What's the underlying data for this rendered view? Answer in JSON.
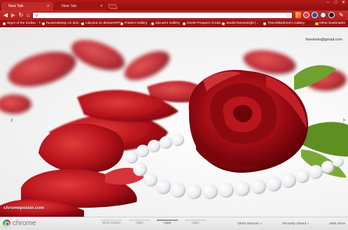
{
  "tabs": [
    {
      "label": "New Tab"
    },
    {
      "label": "New Tab"
    }
  ],
  "omnibox": {
    "value": "",
    "placeholder": ""
  },
  "bookmarks": [
    {
      "label": "Signs of the Zodiac - T..."
    },
    {
      "label": "hussendesign on devi..."
    },
    {
      "label": "Lilacyka on deviantART"
    },
    {
      "label": "Prasa's Gallery"
    },
    {
      "label": "alicuus's Gallery"
    },
    {
      "label": "Derek Prospero Creati..."
    },
    {
      "label": "StudioTwentyEight |..."
    },
    {
      "label": "TheUnlikedOne's Gallery"
    },
    {
      "label": "Other bookmarks"
    }
  ],
  "user": {
    "email": "thevinela@gmail.com"
  },
  "watermark": {
    "text": "chromeposter.com"
  },
  "bottom": {
    "brand": "chrome",
    "sections": [
      {
        "label": "Most visited"
      },
      {
        "label": "Apps"
      },
      {
        "label": "Apps"
      },
      {
        "label": "Apps"
      }
    ],
    "other_devices": "Other Devices",
    "recently_closed": "Recently closed",
    "web_store": "Web Store"
  },
  "icons": {
    "back": "back-arrow-icon",
    "forward": "forward-arrow-icon",
    "reload": "reload-icon",
    "home": "home-icon",
    "star": "star-icon",
    "wrench": "wrench-icon"
  },
  "colors": {
    "tabstrip": "#b41a1a",
    "toolbar": "#c8302e",
    "bookmarks_bar": "#9c1212",
    "rose": "#b5121b"
  }
}
